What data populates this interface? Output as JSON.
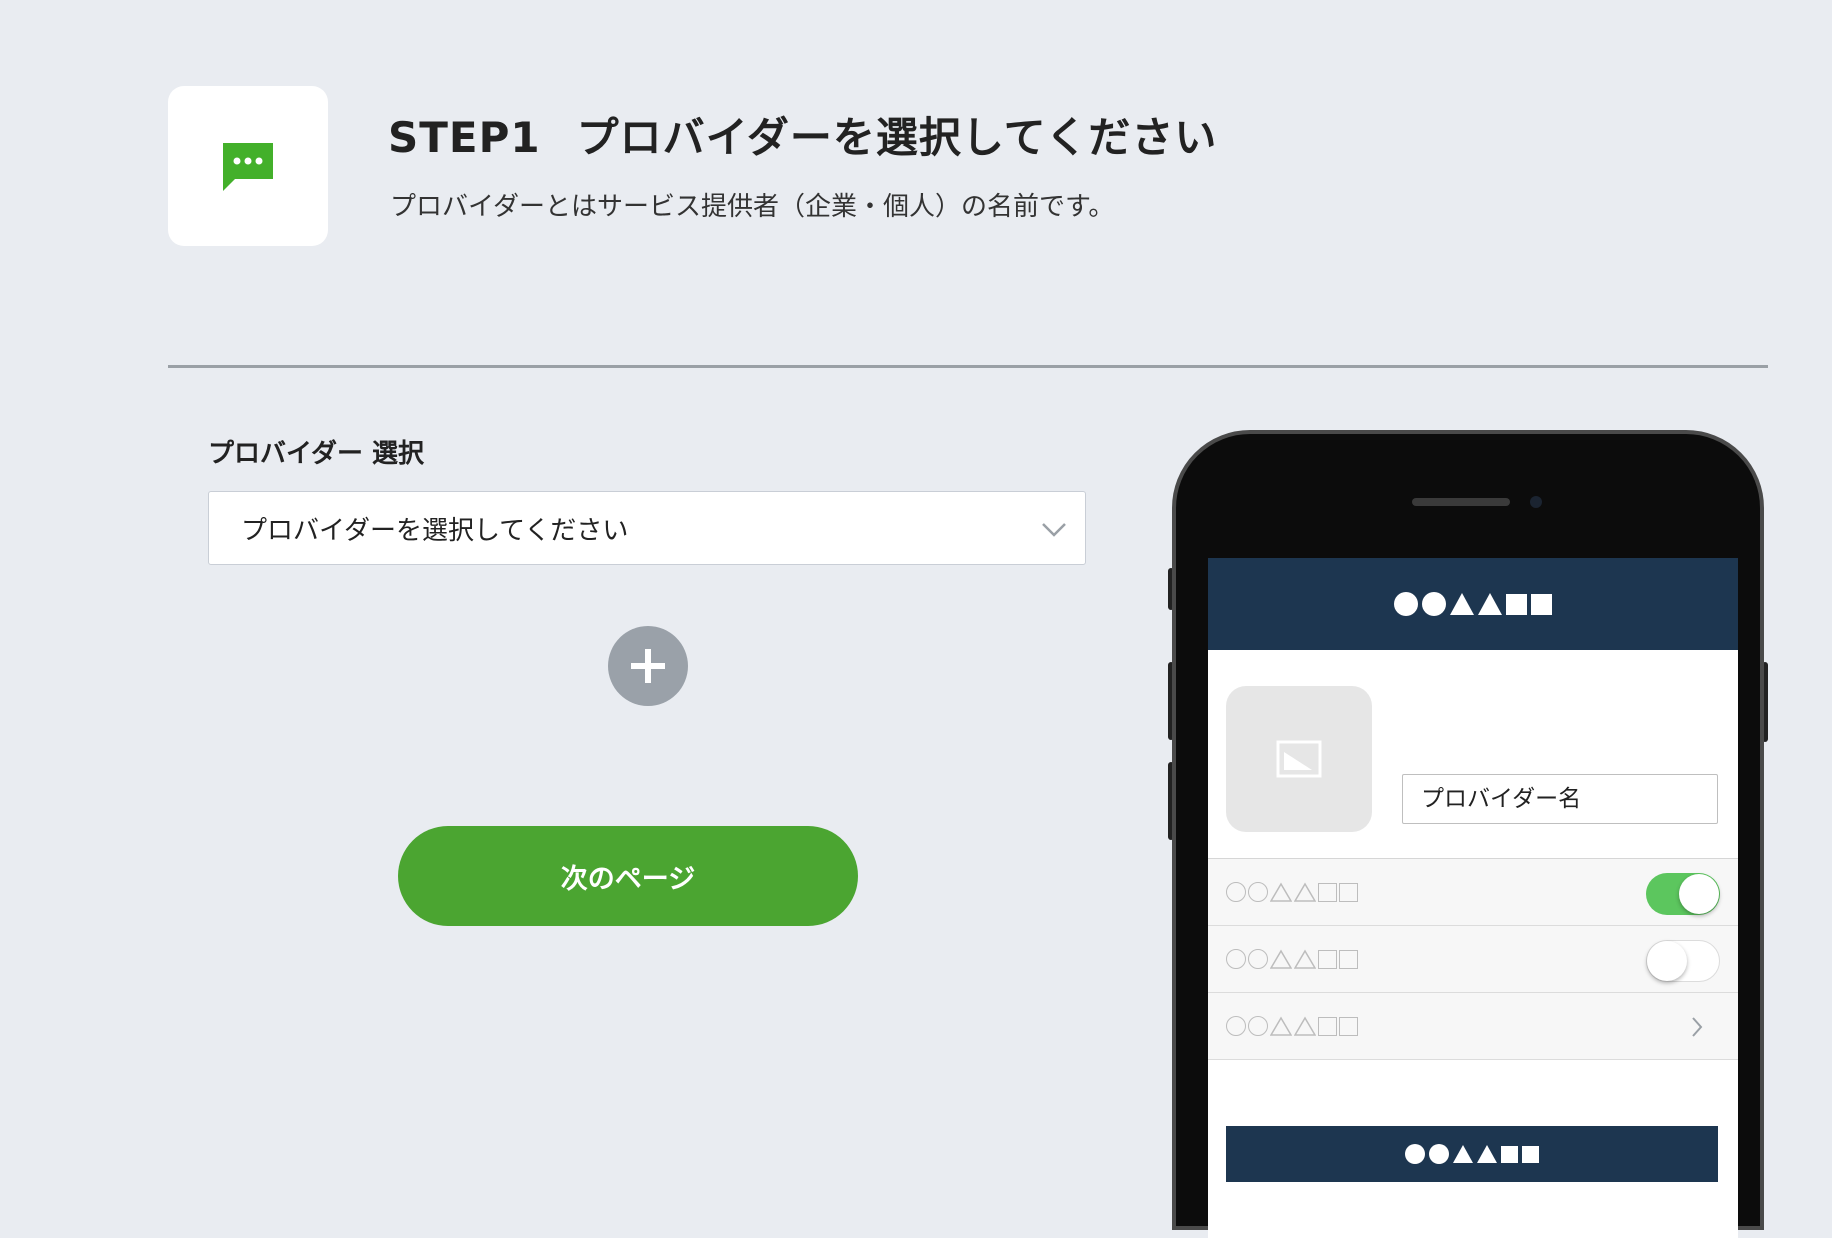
{
  "step": {
    "title_step": "STEP1",
    "title_text": "プロバイダーを選択してください",
    "description": "プロバイダーとはサービス提供者（企業・個人）の名前です。",
    "icon": "chat-bubble-icon"
  },
  "form": {
    "label": "プロバイダー 選択",
    "select_value": "プロバイダーを選択してください",
    "add_icon": "plus-icon",
    "next_button": "次のページ"
  },
  "preview": {
    "provider_name_placeholder": "プロバイダー名",
    "rows": [
      {
        "control": "toggle",
        "state": "on"
      },
      {
        "control": "toggle",
        "state": "off"
      },
      {
        "control": "chevron-right-icon"
      }
    ]
  },
  "colors": {
    "accent_green": "#4ba531",
    "header_navy": "#1d3650",
    "toggle_on": "#5cc65e",
    "background": "#e9ecf1"
  }
}
